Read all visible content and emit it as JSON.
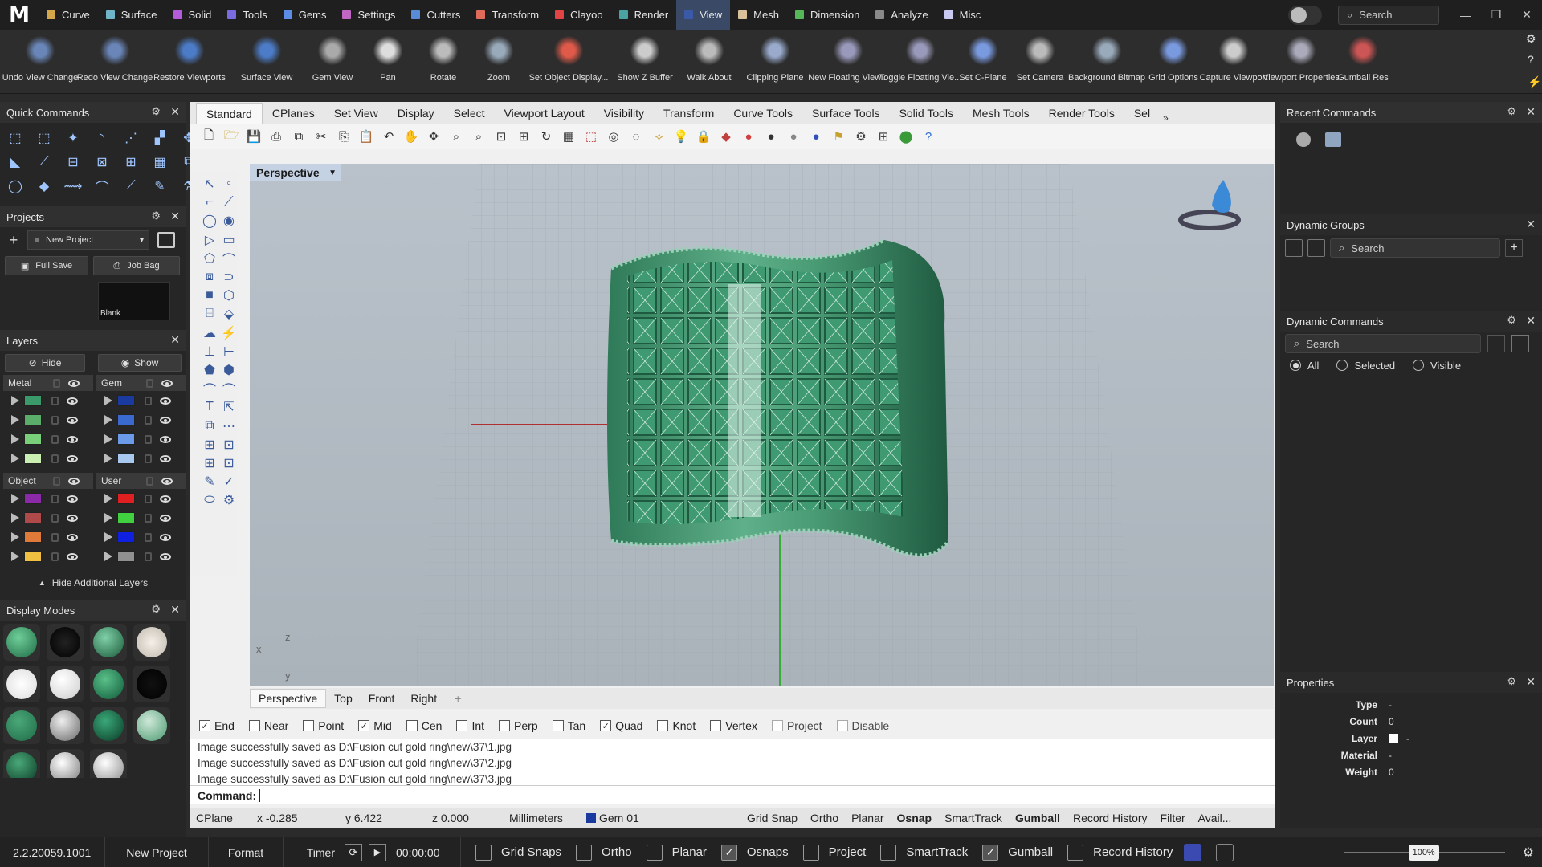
{
  "app": {
    "logo": "M"
  },
  "menubar": {
    "items": [
      {
        "label": "Curve",
        "color": "#d4a84a"
      },
      {
        "label": "Surface",
        "color": "#6fb7c8"
      },
      {
        "label": "Solid",
        "color": "#b35bd9"
      },
      {
        "label": "Tools",
        "color": "#7a6be0"
      },
      {
        "label": "Gems",
        "color": "#5b8de6"
      },
      {
        "label": "Settings",
        "color": "#c067c4"
      },
      {
        "label": "Cutters",
        "color": "#5a8bd6"
      },
      {
        "label": "Transform",
        "color": "#e06b5a"
      },
      {
        "label": "Clayoo",
        "color": "#e04444"
      },
      {
        "label": "Render",
        "color": "#4aa3a3"
      },
      {
        "label": "View",
        "color": "#3a5aa8"
      },
      {
        "label": "Mesh",
        "color": "#d9c29a"
      },
      {
        "label": "Dimension",
        "color": "#55b95a"
      },
      {
        "label": "Analyze",
        "color": "#8a8a8a"
      },
      {
        "label": "Misc",
        "color": "#c9c9f2"
      }
    ],
    "active": "View",
    "search_placeholder": "Search"
  },
  "ribbon": {
    "buttons": [
      {
        "label": "Undo View Change",
        "icon": "undo-view-icon"
      },
      {
        "label": "Redo View Change",
        "icon": "redo-view-icon"
      },
      {
        "label": "Restore Viewports",
        "icon": "restore-viewports-icon"
      },
      {
        "label": "Surface View",
        "icon": "surface-view-icon"
      },
      {
        "label": "Gem View",
        "icon": "gem-view-icon"
      },
      {
        "label": "Pan",
        "icon": "pan-hand-icon"
      },
      {
        "label": "Rotate",
        "icon": "rotate-icon"
      },
      {
        "label": "Zoom",
        "icon": "zoom-icon"
      },
      {
        "label": "Set Object Display...",
        "icon": "object-display-icon"
      },
      {
        "label": "Show Z Buffer",
        "icon": "z-buffer-icon"
      },
      {
        "label": "Walk About",
        "icon": "walk-about-icon"
      },
      {
        "label": "Clipping Plane",
        "icon": "clipping-plane-icon"
      },
      {
        "label": "New Floating View...",
        "icon": "floating-view-icon"
      },
      {
        "label": "Toggle Floating Vie...",
        "icon": "toggle-floating-icon"
      },
      {
        "label": "Set C-Plane",
        "icon": "cplane-icon"
      },
      {
        "label": "Set Camera",
        "icon": "camera-icon"
      },
      {
        "label": "Background Bitmap",
        "icon": "background-bitmap-icon"
      },
      {
        "label": "Grid Options",
        "icon": "grid-options-icon"
      },
      {
        "label": "Capture Viewport",
        "icon": "capture-viewport-icon"
      },
      {
        "label": "Viewport Properties",
        "icon": "viewport-properties-icon"
      },
      {
        "label": "Gumball Res",
        "icon": "gumball-icon"
      }
    ]
  },
  "quick_commands": {
    "title": "Quick Commands"
  },
  "projects": {
    "title": "Projects",
    "project_name": "New Project",
    "full_save": "Full Save",
    "job_bag": "Job Bag",
    "thumbnail_label": "Blank"
  },
  "layers": {
    "title": "Layers",
    "hide": "Hide",
    "show": "Show",
    "groups": [
      {
        "name": "Metal",
        "colors": [
          "#3a9a6a",
          "#5aae6a",
          "#7ad07a",
          "#c9f0b0"
        ]
      },
      {
        "name": "Gem",
        "colors": [
          "#1a3aa0",
          "#3a6ad0",
          "#6a9ae8",
          "#a8c8f0"
        ]
      },
      {
        "name": "Object",
        "colors": [
          "#8a2aa8",
          "#b04a4a",
          "#e07a3a",
          "#f0c040"
        ]
      },
      {
        "name": "User",
        "colors": [
          "#e02020",
          "#40d040",
          "#1020e0",
          "#909090"
        ]
      }
    ],
    "hide_additional": "Hide Additional Layers"
  },
  "display_modes": {
    "title": "Display Modes"
  },
  "toolbar_tabs": {
    "tabs": [
      "Standard",
      "CPlanes",
      "Set View",
      "Display",
      "Select",
      "Viewport Layout",
      "Visibility",
      "Transform",
      "Curve Tools",
      "Surface Tools",
      "Solid Tools",
      "Mesh Tools",
      "Render Tools",
      "Sel"
    ],
    "active": "Standard"
  },
  "viewport": {
    "name": "Perspective",
    "tabs": [
      "Perspective",
      "Top",
      "Front",
      "Right"
    ],
    "active_tab": "Perspective",
    "axis_x": "x",
    "axis_y": "y",
    "axis_z": "z"
  },
  "osnaps": [
    {
      "label": "End",
      "checked": true
    },
    {
      "label": "Near",
      "checked": false
    },
    {
      "label": "Point",
      "checked": false
    },
    {
      "label": "Mid",
      "checked": true
    },
    {
      "label": "Cen",
      "checked": false
    },
    {
      "label": "Int",
      "checked": false
    },
    {
      "label": "Perp",
      "checked": false
    },
    {
      "label": "Tan",
      "checked": false
    },
    {
      "label": "Quad",
      "checked": true
    },
    {
      "label": "Knot",
      "checked": false
    },
    {
      "label": "Vertex",
      "checked": false
    },
    {
      "label": "Project",
      "checked": false,
      "disabled": true
    },
    {
      "label": "Disable",
      "checked": false,
      "disabled": true
    }
  ],
  "history": [
    "Image successfully saved as D:\\Fusion cut gold ring\\new\\37\\1.jpg",
    "Image successfully saved as D:\\Fusion cut gold ring\\new\\37\\2.jpg",
    "Image successfully saved as D:\\Fusion cut gold ring\\new\\37\\3.jpg"
  ],
  "command": {
    "label": "Command:"
  },
  "statusbar": {
    "cplane": "CPlane",
    "x": "x -0.285",
    "y": "y 6.422",
    "z": "z 0.000",
    "units": "Millimeters",
    "layer": "Gem 01",
    "layer_color": "#1a3aa0",
    "toggles": [
      {
        "label": "Grid Snap",
        "bold": false
      },
      {
        "label": "Ortho",
        "bold": false
      },
      {
        "label": "Planar",
        "bold": false
      },
      {
        "label": "Osnap",
        "bold": true
      },
      {
        "label": "SmartTrack",
        "bold": false
      },
      {
        "label": "Gumball",
        "bold": true
      },
      {
        "label": "Record History",
        "bold": false
      },
      {
        "label": "Filter",
        "bold": false
      },
      {
        "label": "Avail...",
        "bold": false
      }
    ]
  },
  "right": {
    "recent": {
      "title": "Recent Commands"
    },
    "dyn_groups": {
      "title": "Dynamic Groups",
      "search": "Search"
    },
    "dyn_commands": {
      "title": "Dynamic Commands",
      "search": "Search",
      "filters": [
        {
          "label": "All",
          "on": true
        },
        {
          "label": "Selected",
          "on": false
        },
        {
          "label": "Visible",
          "on": false
        }
      ]
    },
    "properties": {
      "title": "Properties",
      "rows": [
        {
          "key": "Type",
          "value": "-"
        },
        {
          "key": "Count",
          "value": "0"
        },
        {
          "key": "Layer",
          "value": "-"
        },
        {
          "key": "Material",
          "value": "-"
        },
        {
          "key": "Weight",
          "value": "0"
        }
      ]
    }
  },
  "bottombar": {
    "version": "2.2.20059.1001",
    "project": "New Project",
    "format": "Format",
    "timer": "Timer",
    "time": "00:00:00",
    "toggles": [
      {
        "label": "Grid Snaps",
        "checked": false
      },
      {
        "label": "Ortho",
        "checked": false
      },
      {
        "label": "Planar",
        "checked": false
      },
      {
        "label": "Osnaps",
        "checked": true
      },
      {
        "label": "Project",
        "checked": false
      },
      {
        "label": "SmartTrack",
        "checked": false
      },
      {
        "label": "Gumball",
        "checked": true
      },
      {
        "label": "Record History",
        "checked": false
      }
    ],
    "zoom": "100%"
  }
}
